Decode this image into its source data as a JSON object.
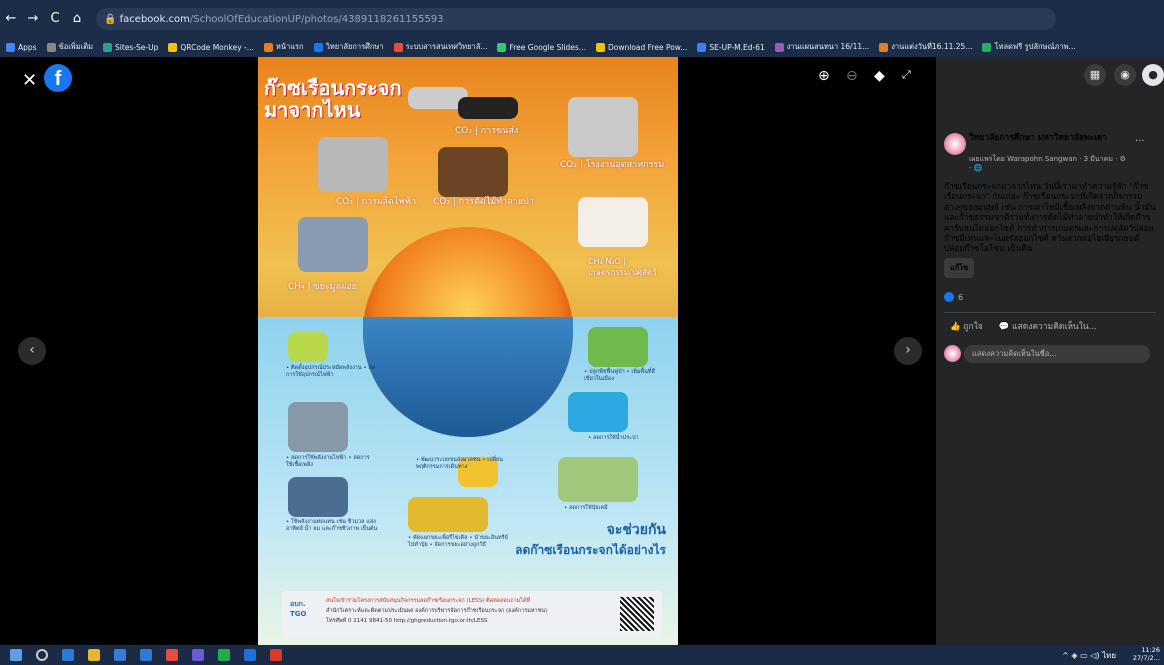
{
  "browser": {
    "url_host": "facebook.com",
    "url_path": "/SchoolOfEducationUP/photos/4389118261155593",
    "bookmarks": [
      "Apps",
      "ข้อเพิ่มเติม",
      "Sites-Se-Up",
      "QRCode Monkey -...",
      "หน้าแรก",
      "วิทยาลัยการศึกษา",
      "ระบบสารสนเทศวิทยาลั...",
      "Free Google Slides...",
      "Download Free Pow...",
      "SE-UP-M.Ed-61",
      "งานแผนสนทนา 16/11...",
      "งานแต่งวันที่16.11.25...",
      "โหลดฟรี รูปลักษณ์ภาพ..."
    ]
  },
  "poster": {
    "title_line1": "ก๊าซเรือนกระจก",
    "title_line2": "มาจากไหน",
    "sources": [
      {
        "label": "CO₂ | การขนส่ง"
      },
      {
        "label": "CO₂ | โรงงานอุตสาหกรรม"
      },
      {
        "label": "CO₂ | การผลิตไฟฟ้า"
      },
      {
        "label": "CO₂ | การตัดไม้ทำลายป่า"
      },
      {
        "label": "CH₄ | ขยะมูลฝอย"
      },
      {
        "label": "CH₄ N₂O | เกษตรกรรม/ปศุสัตว์"
      }
    ],
    "solutions": [
      "• ติดตั้งอุปกรณ์ประหยัดพลังงาน • ลดการใช้อุปกรณ์ไฟฟ้า",
      "• ปลูกพืชฟื้นฟูป่า • เพิ่มพื้นที่สีเขียวในเมือง",
      "• ลดการใช้น้ำประปา",
      "• ลดการใช้พลังงานไฟฟ้า • ลดการใช้เชื้อเพลิง",
      "• พัฒนาระบบขนส่งมวลชน • เปลี่ยนพฤติกรรมการเดินทาง",
      "• ลดการใช้ปุ๋ยเคมี",
      "• ใช้พลังงานทดแทน เช่น ชีวมวล แสงอาทิตย์ น้ำ ลม และก๊าซชีวภาพ เป็นต้น",
      "• คัดแยกขยะเพื่อรีไซเคิล • นำขยะอินทรีย์ไปทำปุ๋ย • จัดการขยะอย่างถูกวิธี"
    ],
    "tagline1": "จะช่วยกัน",
    "tagline2": "ลดก๊าซเรือนกระจกได้อย่างไร",
    "footer1": "สนใจเข้าร่วมโครงการสนับสนุนกิจกรรมลดก๊าซเรือนกระจก (LESS) ติดต่อสอบถามได้ที่",
    "footer2": "สำนักวิเคราะห์และติดตามประเมินผล องค์การบริหารจัดการก๊าซเรือนกระจก (องค์การมหาชน)",
    "footer3": "โทรศัพท์ 0 2141 9841-50 http://ghgreduction.tgo.or.th/LESS",
    "org": "อบก. TGO"
  },
  "post": {
    "page_name": "วิทยาลัยการศึกษา มหาวิทยาลัยพะเยา",
    "posted_by": "เผยแพร่โดย Warapohn Sangwan ·",
    "date": "3 มีนาคม · ⚙ · 🌐",
    "caption": "ก๊าซเรือนกระจกมาจากไหน วันนี้เรามาทำความรู้จัก \"ก๊าซเรือนกระจก\" กันเถอะ ก๊าซเรือนกระจกที่เกิดจากกิจกรรมต่างๆของมนุษย์ เช่น การเผาไหม้เชื้อเพลิงจากถ่านหิน น้ำมันและก๊าซธรรมชาติรวมทั้งการตัดไม้ทำลายป่าทำให้เกิดก๊าซคาร์บอนไดออกไซด์ การทำการเกษตรและการปศุสัตว์ปล่อยก๊าซมีเทนและไนตรัสออกไซด์ ควันจากท่อไอเสียรถยนต์ปล่อยก๊าซโอโซน เป็นต้น",
    "edit": "แก้ไข",
    "reaction_count": "6",
    "like": "ถูกใจ",
    "comment_action": "แสดงความคิดเห็นใน...",
    "comment_placeholder": "แสดงความคิดเห็นในชื่อ..."
  },
  "taskbar": {
    "time": "11:26",
    "date": "27/7/2..."
  }
}
